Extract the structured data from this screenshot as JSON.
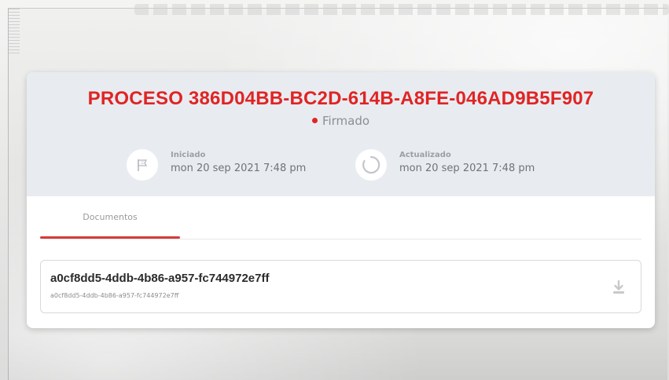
{
  "process": {
    "title": "PROCESO 386D04BB-BC2D-614B-A8FE-046AD9B5F907",
    "status": "Firmado",
    "status_color": "#e02424",
    "started": {
      "label": "Iniciado",
      "value": "mon 20 sep 2021 7:48 pm",
      "icon": "flag-icon"
    },
    "updated": {
      "label": "Actualizado",
      "value": "mon 20 sep 2021 7:48 pm",
      "icon": "refresh-icon"
    }
  },
  "tabs": [
    {
      "label": "Documentos",
      "active": true
    }
  ],
  "documents": [
    {
      "name": "a0cf8dd5-4ddb-4b86-a957-fc744972e7ff",
      "subtitle": "a0cf8dd5-4ddb-4b86-a957-fc744972e7ff",
      "action_icon": "download-icon"
    }
  ],
  "colors": {
    "accent": "#e02424",
    "header_bg": "#e8ecf0"
  }
}
